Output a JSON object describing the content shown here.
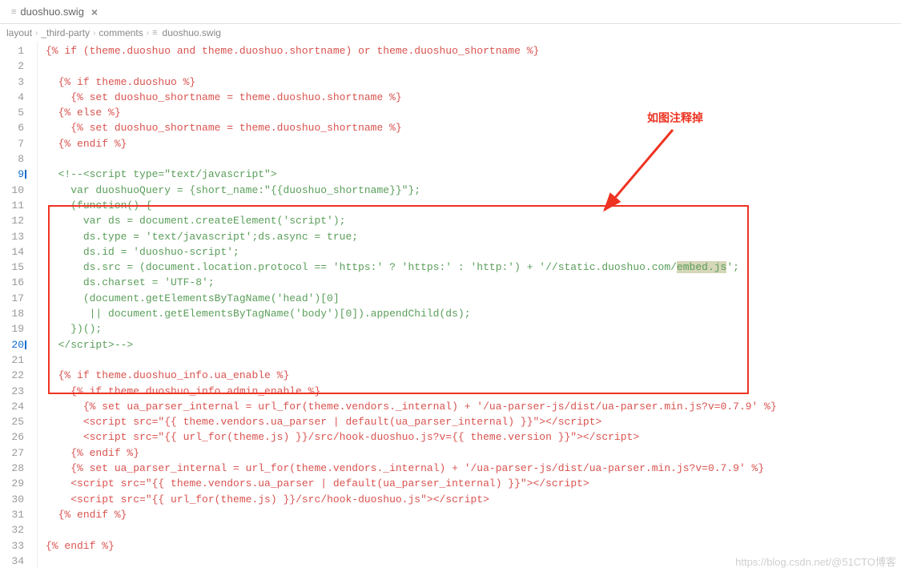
{
  "tab": {
    "name": "duoshuo.swig"
  },
  "breadcrumbs": [
    "layout",
    "_third-party",
    "comments",
    "duoshuo.swig"
  ],
  "annotation": "如图注释掉",
  "watermark": "https://blog.csdn.net/@51CTO博客",
  "highlighted_lines": [
    9,
    20
  ],
  "code_lines": [
    {
      "n": 1,
      "ind": 0,
      "seg": [
        {
          "t": "{% if (theme.duoshuo and theme.duoshuo.shortname) or theme.duoshuo_shortname %}",
          "c": "tag"
        }
      ]
    },
    {
      "n": 2,
      "ind": 0,
      "seg": []
    },
    {
      "n": 3,
      "ind": 1,
      "seg": [
        {
          "t": "{% if theme.duoshuo %}",
          "c": "tag"
        }
      ]
    },
    {
      "n": 4,
      "ind": 2,
      "seg": [
        {
          "t": "{% set duoshuo_shortname = theme.duoshuo.shortname %}",
          "c": "tag"
        }
      ]
    },
    {
      "n": 5,
      "ind": 1,
      "seg": [
        {
          "t": "{% else %}",
          "c": "tag"
        }
      ]
    },
    {
      "n": 6,
      "ind": 2,
      "seg": [
        {
          "t": "{% set duoshuo_shortname = theme.duoshuo_shortname %}",
          "c": "tag"
        }
      ]
    },
    {
      "n": 7,
      "ind": 1,
      "seg": [
        {
          "t": "{% endif %}",
          "c": "tag"
        }
      ]
    },
    {
      "n": 8,
      "ind": 0,
      "seg": []
    },
    {
      "n": 9,
      "ind": 1,
      "seg": [
        {
          "t": "<!--<script type=\"text/javascript\">",
          "c": "comment"
        }
      ]
    },
    {
      "n": 10,
      "ind": 2,
      "seg": [
        {
          "t": "var duoshuoQuery = {short_name:\"{{duoshuo_shortname}}\"};",
          "c": "comment"
        }
      ]
    },
    {
      "n": 11,
      "ind": 2,
      "seg": [
        {
          "t": "(function() {",
          "c": "comment"
        }
      ]
    },
    {
      "n": 12,
      "ind": 3,
      "seg": [
        {
          "t": "var ds = document.createElement('script');",
          "c": "comment"
        }
      ]
    },
    {
      "n": 13,
      "ind": 3,
      "seg": [
        {
          "t": "ds.type = 'text/javascript';ds.async = true;",
          "c": "comment"
        }
      ]
    },
    {
      "n": 14,
      "ind": 3,
      "seg": [
        {
          "t": "ds.id = 'duoshuo-script';",
          "c": "comment"
        }
      ]
    },
    {
      "n": 15,
      "ind": 3,
      "seg": [
        {
          "t": "ds.src = (document.location.protocol == 'https:' ? 'https:' : 'http:') + '//static.duoshuo.com/",
          "c": "comment"
        },
        {
          "t": "embed.js",
          "c": "comment",
          "h": true
        },
        {
          "t": "';",
          "c": "comment"
        }
      ]
    },
    {
      "n": 16,
      "ind": 3,
      "seg": [
        {
          "t": "ds.charset = 'UTF-8';",
          "c": "comment"
        }
      ]
    },
    {
      "n": 17,
      "ind": 3,
      "seg": [
        {
          "t": "(document.getElementsByTagName('head')[0]",
          "c": "comment"
        }
      ]
    },
    {
      "n": 18,
      "ind": 3,
      "seg": [
        {
          "t": " || document.getElementsByTagName('body')[0]).appendChild(ds);",
          "c": "comment"
        }
      ]
    },
    {
      "n": 19,
      "ind": 2,
      "seg": [
        {
          "t": "})();",
          "c": "comment"
        }
      ]
    },
    {
      "n": 20,
      "ind": 1,
      "seg": [
        {
          "t": "<​/script>-->",
          "c": "comment"
        }
      ]
    },
    {
      "n": 21,
      "ind": 0,
      "seg": []
    },
    {
      "n": 22,
      "ind": 1,
      "seg": [
        {
          "t": "{% if theme.duoshuo_info.ua_enable %}",
          "c": "tag"
        }
      ]
    },
    {
      "n": 23,
      "ind": 2,
      "seg": [
        {
          "t": "{% if theme.duoshuo_info.admin_enable %}",
          "c": "tag"
        }
      ]
    },
    {
      "n": 24,
      "ind": 3,
      "seg": [
        {
          "t": "{% set ua_parser_internal = url_for(theme.vendors._internal) + '/ua-parser-js/dist/ua-parser.min.js?v=0.7.9' %}",
          "c": "tag"
        }
      ]
    },
    {
      "n": 25,
      "ind": 3,
      "seg": [
        {
          "t": "<script src=\"{{ theme.vendors.ua_parser | default(ua_parser_internal) }}\"><​/script>",
          "c": "tag"
        }
      ]
    },
    {
      "n": 26,
      "ind": 3,
      "seg": [
        {
          "t": "<script src=\"{{ url_for(theme.js) }}/src/hook-duoshuo.js?v={{ theme.version }}\"><​/script>",
          "c": "tag"
        }
      ]
    },
    {
      "n": 27,
      "ind": 2,
      "seg": [
        {
          "t": "{% endif %}",
          "c": "tag"
        }
      ]
    },
    {
      "n": 28,
      "ind": 2,
      "seg": [
        {
          "t": "{% set ua_parser_internal = url_for(theme.vendors._internal) + '/ua-parser-js/dist/ua-parser.min.js?v=0.7.9' %}",
          "c": "tag"
        }
      ]
    },
    {
      "n": 29,
      "ind": 2,
      "seg": [
        {
          "t": "<script src=\"{{ theme.vendors.ua_parser | default(ua_parser_internal) }}\"><​/script>",
          "c": "tag"
        }
      ]
    },
    {
      "n": 30,
      "ind": 2,
      "seg": [
        {
          "t": "<script src=\"{{ url_for(theme.js) }}/src/hook-duoshuo.js\"><​/script>",
          "c": "tag"
        }
      ]
    },
    {
      "n": 31,
      "ind": 1,
      "seg": [
        {
          "t": "{% endif %}",
          "c": "tag"
        }
      ]
    },
    {
      "n": 32,
      "ind": 0,
      "seg": []
    },
    {
      "n": 33,
      "ind": 0,
      "seg": [
        {
          "t": "{% endif %}",
          "c": "tag"
        }
      ]
    },
    {
      "n": 34,
      "ind": 0,
      "seg": []
    }
  ]
}
